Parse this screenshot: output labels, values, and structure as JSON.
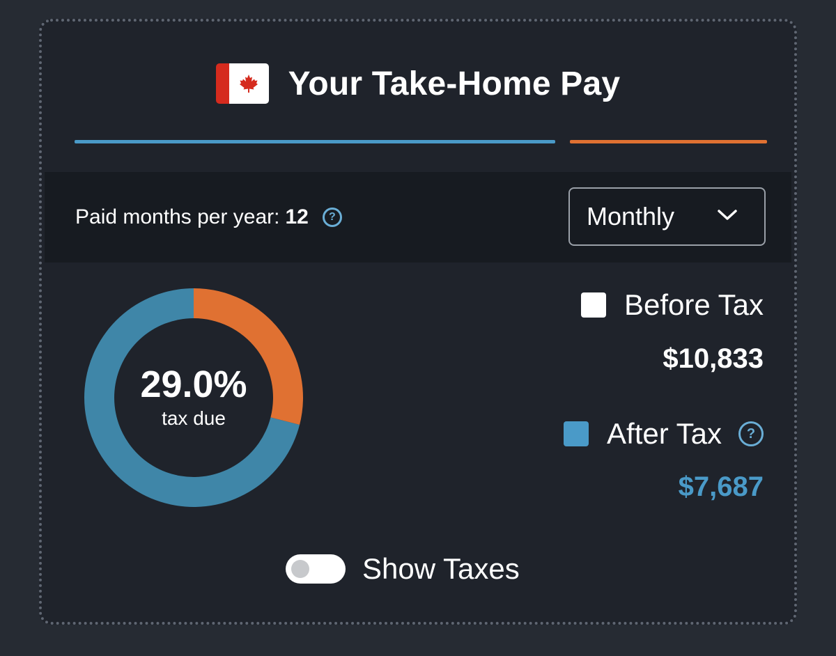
{
  "header": {
    "title": "Your Take-Home Pay",
    "flag_icon": "canada-flag-icon"
  },
  "colors": {
    "after_tax": "#4a9ac8",
    "tax": "#e07132",
    "before_tax": "#ffffff",
    "background": "#1f232b"
  },
  "pay_settings": {
    "paid_months_label": "Paid months per year:",
    "paid_months_value": "12",
    "frequency_selected": "Monthly"
  },
  "chart_data": {
    "type": "pie",
    "segments": [
      {
        "name": "Tax",
        "value": 29.0
      },
      {
        "name": "After Tax",
        "value": 71.0
      }
    ],
    "center_value": "29.0%",
    "center_label": "tax due"
  },
  "legend": {
    "before_tax": {
      "label": "Before Tax",
      "amount": "$10,833"
    },
    "after_tax": {
      "label": "After Tax",
      "amount": "$7,687"
    }
  },
  "toggle": {
    "label": "Show Taxes",
    "on": false
  }
}
